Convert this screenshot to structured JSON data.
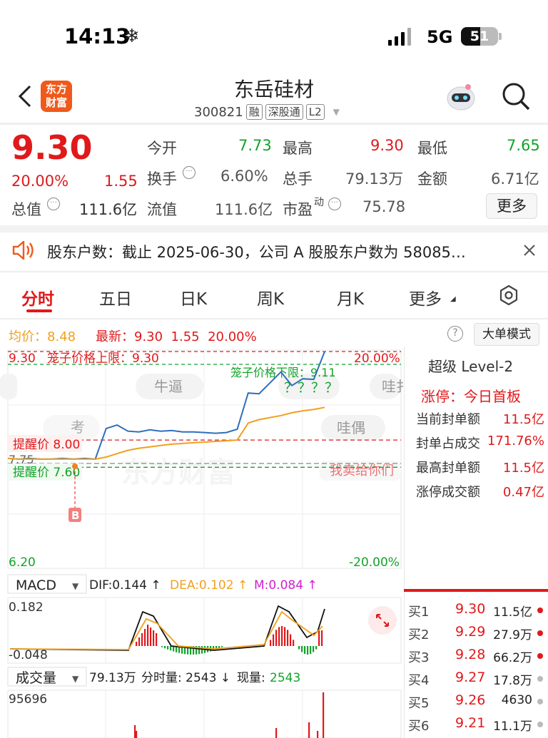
{
  "status_bar": {
    "time": "14:13",
    "network": "5G",
    "battery": "51",
    "battery_level": 0.51
  },
  "header": {
    "name": "东岳硅材",
    "code": "300821",
    "tags": [
      "融",
      "深股通",
      "L2"
    ],
    "logo_text": "东方财富"
  },
  "quote": {
    "price": "9.30",
    "change_pct": "20.00%",
    "change": "1.55",
    "rows": [
      [
        {
          "label": "今开",
          "value": "7.73",
          "color": "green"
        },
        {
          "label": "最高",
          "value": "9.30",
          "color": "red"
        },
        {
          "label": "最低",
          "value": "7.65",
          "color": "green"
        }
      ],
      [
        {
          "label": "换手",
          "value": "6.60%",
          "color": "gray"
        },
        {
          "label": "总手",
          "value": "79.13万",
          "color": "gray"
        },
        {
          "label": "金额",
          "value": "6.71亿",
          "color": "gray"
        }
      ],
      [
        {
          "label": "流值",
          "value": "111.6亿",
          "color": "gray"
        },
        {
          "label": "市盈",
          "value": "75.78",
          "color": "gray"
        }
      ]
    ],
    "total_value_label": "总值",
    "total_value": "111.6亿",
    "pe_superscript": "动",
    "more_label": "更多"
  },
  "notice": {
    "text": "股东户数：截止 2025-06-30，公司 A 股股东户数为 58085…"
  },
  "tabs": [
    "分时",
    "五日",
    "日K",
    "周K",
    "月K",
    "更多"
  ],
  "chart_info": {
    "avg_label": "均价：",
    "avg_value": "8.48",
    "latest_label": "最新：",
    "latest_value": "9.30",
    "latest_change": "1.55",
    "latest_pct": "20.00%",
    "big_order_mode": "大单模式",
    "top_left": "9.30",
    "cage_upper": "笼子价格上限：9.30",
    "cage_lower": "笼子价格下限：9.11",
    "question_marks": "？？？？",
    "top_right": "20.00%",
    "bottom_left": "6.20",
    "bottom_right": "-20.00%",
    "mid_tick": "7.75",
    "alert_high": "提醒价 8.00",
    "alert_low": "提醒价 7.60",
    "bubble_1": "牛逼",
    "bubble_2": "哇扌",
    "bubble_3": "考",
    "bubble_4": "哇偶",
    "sell_buy_text": "我卖给你们",
    "watermark": "东方财富",
    "b_marker": "B"
  },
  "chart_data": {
    "type": "line",
    "title": "",
    "series": [
      {
        "name": "最新",
        "color": "#2f6fba",
        "values": [
          7.73,
          7.72,
          7.73,
          7.72,
          7.72,
          7.73,
          7.72,
          7.73,
          7.72,
          8.17,
          8.22,
          8.13,
          8.12,
          8.15,
          8.13,
          8.14,
          8.12,
          8.12,
          8.11,
          8.1,
          8.11,
          8.16,
          8.69,
          8.68,
          8.84,
          9.0,
          8.8,
          8.9,
          8.89,
          9.3
        ]
      },
      {
        "name": "均价",
        "color": "#f0a020",
        "values": [
          7.73,
          7.72,
          7.72,
          7.72,
          7.72,
          7.72,
          7.72,
          7.72,
          7.72,
          7.75,
          7.8,
          7.85,
          7.88,
          7.9,
          7.92,
          7.94,
          7.95,
          7.96,
          7.97,
          7.98,
          7.99,
          8.0,
          8.25,
          8.3,
          8.33,
          8.36,
          8.4,
          8.43,
          8.45,
          8.48
        ]
      }
    ],
    "ylim": [
      6.2,
      9.3
    ],
    "alerts": [
      8.0,
      7.6
    ],
    "cage_lower": 9.11,
    "macd": {
      "label": "MACD",
      "dif": "DIF:0.144 ↑",
      "dea": "DEA:0.102 ↑",
      "m": "M:0.084 ↑",
      "top": "0.182",
      "bottom": "-0.048"
    },
    "volume": {
      "label": "成交量",
      "total": "79.13万",
      "period_label": "分时量: 2543 ↓",
      "now_label": "现量:",
      "now_value": "2543",
      "max": "95696"
    }
  },
  "level2": {
    "title": "超级 Level-2",
    "limit_status": "涨停：今日首板",
    "items": [
      {
        "label": "当前封单额",
        "value": "11.5亿"
      },
      {
        "label": "封单占成交",
        "value": "171.76%"
      },
      {
        "label": "最高封单额",
        "value": "11.5亿"
      },
      {
        "label": "涨停成交额",
        "value": "0.47亿"
      }
    ],
    "bids": [
      {
        "label": "买1",
        "price": "9.30",
        "vol": "11.5亿",
        "dot": "#e0191b"
      },
      {
        "label": "买2",
        "price": "9.29",
        "vol": "27.9万",
        "dot": "#e0191b"
      },
      {
        "label": "买3",
        "price": "9.28",
        "vol": "66.2万",
        "dot": "#e0191b"
      },
      {
        "label": "买4",
        "price": "9.27",
        "vol": "17.8万",
        "dot": "#bbb"
      },
      {
        "label": "买5",
        "price": "9.26",
        "vol": "4630",
        "dot": "#bbb"
      },
      {
        "label": "买6",
        "price": "9.21",
        "vol": "11.1万",
        "dot": "#bbb"
      }
    ]
  }
}
